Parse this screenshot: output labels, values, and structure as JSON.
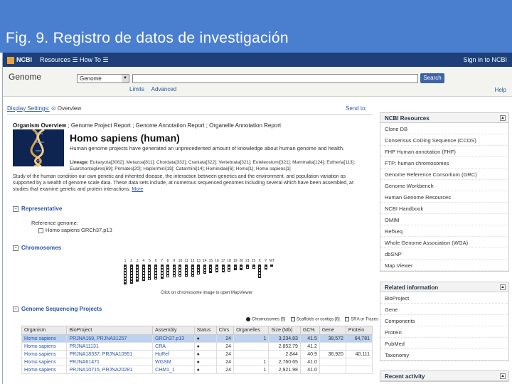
{
  "slide": {
    "title": "Fig. 9. Registro de datos de investigación"
  },
  "colors": {
    "slide_header": "#4a7fd0",
    "ncbi_bar": "#1e3f7a",
    "link": "#2a55a4",
    "selected_row": "#bcd2ee"
  },
  "ncbi_bar": {
    "logo": "NCBI",
    "resources": "Resources ☰",
    "howto": "How To ☰",
    "signin": "Sign in to NCBI"
  },
  "search": {
    "db_label": "Genome",
    "db_value": "Genome",
    "button": "Search",
    "limits": "Limits",
    "advanced": "Advanced",
    "help": "Help"
  },
  "display": {
    "settings": "Display Settings:",
    "view": "Overview",
    "send_to": "Send to:"
  },
  "breadcrumb": {
    "overview": "Organism Overview",
    "project_report": "Genome Project Report",
    "annotation_report": "Genome Annotation Report",
    "organelle_report": "Organelle Annotation Report"
  },
  "organism": {
    "name": "Homo sapiens (human)",
    "description": "Human genome projects have generated an unprecedented amount of knowledge about human genome and health.",
    "lineage_label": "Lineage:",
    "lineage": "Eukaryota[3082]; Metazoa[811]; Chordata[332]; Craniata[322]; Vertebrata[321]; Euteleostomi[321]; Mammalia[124]; Eutheria[113]; Euarchontoglires[69]; Primates[20]; Haplorrhini[19]; Catarrhini[14]; Hominidae[6]; Homo[1]; Homo sapiens[1]",
    "study": "Study of the human condition our own genetic and inherited disease, the interaction between genetics and the environment, and population variation as supported by a wealth of genome scale data. These data sets include, at numerous sequenced genomes including several which have been assembled, at studies that examine genetic and protein interactions.",
    "more": "More"
  },
  "representative": {
    "section": "Representative",
    "reference_label": "Reference genome:",
    "reference_value": "Homo sapiens GRCh37.p13"
  },
  "chromosomes": {
    "section": "Chromosomes",
    "labels": [
      "1",
      "2",
      "3",
      "4",
      "5",
      "6",
      "7",
      "8",
      "9",
      "10",
      "11",
      "12",
      "13",
      "14",
      "15",
      "16",
      "17",
      "18",
      "19",
      "20",
      "21",
      "22",
      "X",
      "Y",
      "MT"
    ],
    "caption": "Click on chromosome image to open MapViewer"
  },
  "sequencing": {
    "section": "Genome Sequencing Projects",
    "legend_chromosomes": "Chromosomes [5]",
    "legend_scaffolds": "Scaffolds or contigs [6]",
    "legend_sra": "SRA or Traces [10]",
    "columns": [
      "Organism",
      "BioProject",
      "Assembly",
      "Status",
      "Chrs",
      "Organelles",
      "Size (Mb)",
      "GC%",
      "Gene",
      "Protein"
    ],
    "rows": [
      [
        "Homo sapiens",
        "PRJNA168, PRJNA31257",
        "GRCh37.p13",
        "●",
        "24",
        "1",
        "3,234.83",
        "41.5",
        "38,572",
        "64,781"
      ],
      [
        "Homo sapiens",
        "PRJNA11131",
        "CRA",
        "●",
        "24",
        "",
        "2,852.79",
        "41.2",
        "",
        ""
      ],
      [
        "Homo sapiens",
        "PRJNA18337, PRJNA10951",
        "HuRef",
        "●",
        "24",
        "",
        "2,844",
        "40.9",
        "36,920",
        "40,111"
      ],
      [
        "Homo sapiens",
        "PRJNA61471",
        "WGSM",
        "●",
        "24",
        "1",
        "2,760.65",
        "41.0",
        "",
        ""
      ],
      [
        "Homo sapiens",
        "PRJNA10715, PRJNA20281",
        "CHM1_1",
        "●",
        "24",
        "1",
        "2,921.98",
        "41.0",
        "",
        ""
      ]
    ]
  },
  "sidebar": {
    "resources": {
      "heading": "NCBI Resources",
      "items": [
        "Clone DB",
        "Consensus CoDing Sequence (CCDS)",
        "FHP Human annotation (FHF)",
        "FTP: human chromosomes",
        "Genome Reference Consortium (GRC)",
        "Genome Workbench",
        "Human Genome Resources",
        "NCBI Handbook",
        "OMIM",
        "RefSeq",
        "Whole Genome Association (WGA)",
        "dbSNP",
        "Map Viewer"
      ]
    },
    "related": {
      "heading": "Related information",
      "items": [
        "BioProject",
        "Gene",
        "Components",
        "Protein",
        "PubMed",
        "Taxonomy"
      ]
    },
    "recent": {
      "heading": "Recent activity"
    }
  }
}
